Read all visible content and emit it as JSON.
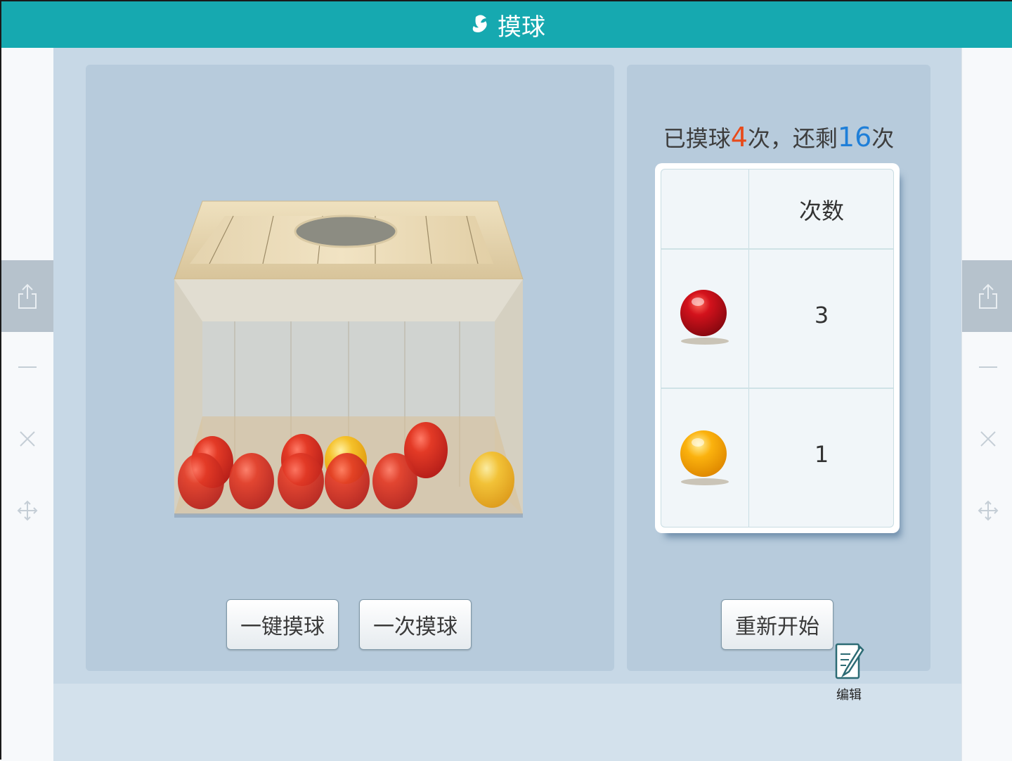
{
  "app": {
    "title": "摸球"
  },
  "rail": {
    "icons": [
      "share-icon",
      "minimize-icon",
      "close-icon",
      "move-icon"
    ]
  },
  "box": {
    "balls": [
      {
        "color": "red"
      },
      {
        "color": "red"
      },
      {
        "color": "red"
      },
      {
        "color": "red"
      },
      {
        "color": "red"
      },
      {
        "color": "red"
      },
      {
        "color": "red"
      },
      {
        "color": "red"
      },
      {
        "color": "yellow"
      },
      {
        "color": "yellow"
      }
    ]
  },
  "buttons": {
    "auto_draw": "一键摸球",
    "single_draw": "一次摸球",
    "restart": "重新开始"
  },
  "status": {
    "prefix": "已摸球",
    "drawn": "4",
    "mid": "次，还剩",
    "remaining": "16",
    "suffix": "次"
  },
  "table": {
    "header": "次数",
    "rows": [
      {
        "ball": "red",
        "count": "3"
      },
      {
        "ball": "yellow",
        "count": "1"
      }
    ]
  },
  "edit": {
    "label": "编辑"
  },
  "colors": {
    "titlebar": "#16a9b0",
    "red_ball": "#c8101a",
    "yellow_ball": "#f5a300",
    "drawn_count": "#e84a1a",
    "remaining_count": "#1f7fd8"
  }
}
